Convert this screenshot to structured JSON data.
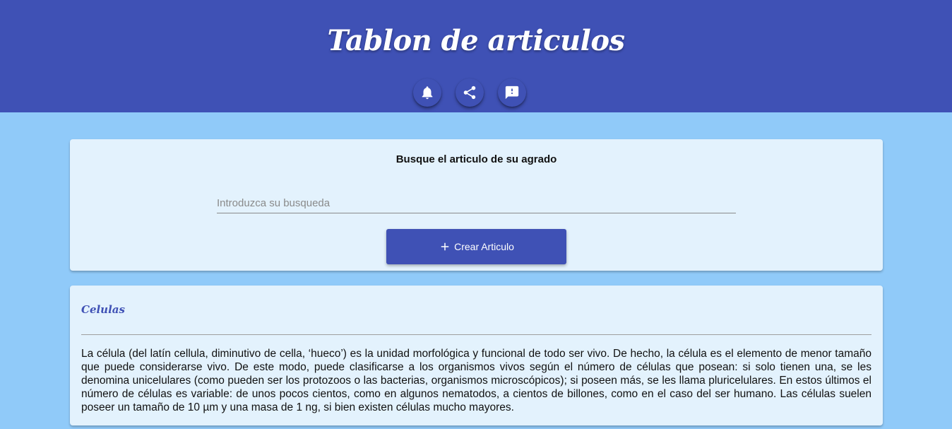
{
  "header": {
    "title": "Tablon de articulos",
    "actions": [
      {
        "icon": "bell-icon"
      },
      {
        "icon": "share-icon"
      },
      {
        "icon": "feedback-icon"
      }
    ]
  },
  "search": {
    "title": "Busque el articulo de su agrado",
    "placeholder": "Introduzca su busqueda",
    "value": "",
    "create_label": "Crear Articulo",
    "create_icon": "plus-icon"
  },
  "article": {
    "title": "Celulas",
    "body": "La célula (del latín cellula, diminutivo de cella, ‘hueco’) es la unidad morfológica y funcional de todo ser vivo. De hecho, la célula es el elemento de menor tamaño que puede considerarse vivo. De este modo, puede clasificarse a los organismos vivos según el número de células que posean: si solo tienen una, se les denomina unicelulares (como pueden ser los protozoos o las bacterias, organismos microscópicos); si poseen más, se les llama pluricelulares. En estos últimos el número de células es variable: de unos pocos cientos, como en algunos nematodos, a cientos de billones, como en el caso del ser humano. Las células suelen poseer un tamaño de 10 µm y una masa de 1 ng, si bien existen células mucho mayores."
  },
  "colors": {
    "primary": "#3f51b5",
    "background": "#90caf9",
    "card": "#e3f2fd"
  }
}
